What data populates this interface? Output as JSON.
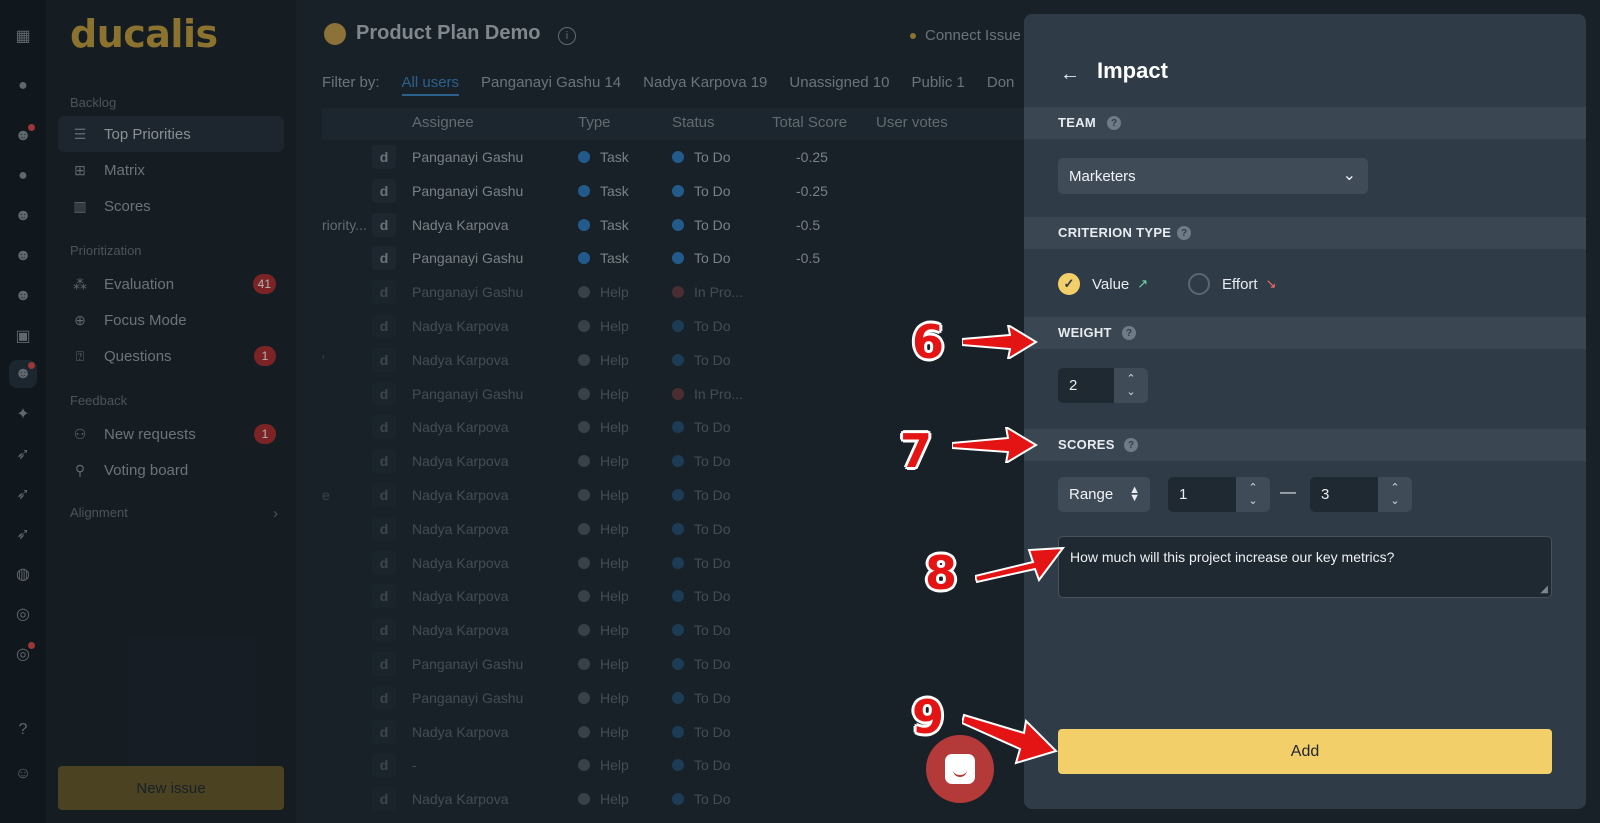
{
  "app": {
    "logo": "ducalis",
    "project_title": "Product Plan Demo",
    "connect_label": "Connect Issue"
  },
  "sidebar": {
    "sections": [
      {
        "title": "Backlog",
        "items": [
          {
            "label": "Top Priorities",
            "icon": "list-icon",
            "active": true
          },
          {
            "label": "Matrix",
            "icon": "grid-icon"
          },
          {
            "label": "Scores",
            "icon": "columns-icon"
          }
        ]
      },
      {
        "title": "Prioritization",
        "items": [
          {
            "label": "Evaluation",
            "icon": "nodes-icon",
            "badge": "41"
          },
          {
            "label": "Focus Mode",
            "icon": "target-icon"
          },
          {
            "label": "Questions",
            "icon": "question-box-icon",
            "badge": "1"
          }
        ]
      },
      {
        "title": "Feedback",
        "items": [
          {
            "label": "New requests",
            "icon": "people-icon",
            "badge": "1"
          },
          {
            "label": "Voting board",
            "icon": "pin-icon"
          }
        ]
      }
    ],
    "alignment_label": "Alignment",
    "new_issue_label": "New issue"
  },
  "filters": {
    "label": "Filter by:",
    "options": [
      "All users",
      "Panganayi Gashu 14",
      "Nadya Karpova 19",
      "Unassigned 10",
      "Public 1",
      "Don"
    ]
  },
  "table": {
    "headers": [
      "Assignee",
      "Type",
      "Status",
      "Total Score",
      "User votes"
    ],
    "rows": [
      {
        "title": "",
        "avatar": "d",
        "assignee": "Panganayi Gashu",
        "type": "Task",
        "type_color": "#2f7fc4",
        "status": "To Do",
        "status_color": "#2f7fc4",
        "score": "-0.25",
        "dim": false
      },
      {
        "title": "",
        "avatar": "d",
        "assignee": "Panganayi Gashu",
        "type": "Task",
        "type_color": "#2f7fc4",
        "status": "To Do",
        "status_color": "#2f7fc4",
        "score": "-0.25",
        "dim": false
      },
      {
        "title": "riority...",
        "avatar": "d",
        "assignee": "Nadya Karpova",
        "type": "Task",
        "type_color": "#2f7fc4",
        "status": "To Do",
        "status_color": "#2f7fc4",
        "score": "-0.5",
        "dim": false
      },
      {
        "title": "",
        "avatar": "d",
        "assignee": "Panganayi Gashu",
        "type": "Task",
        "type_color": "#2f7fc4",
        "status": "To Do",
        "status_color": "#2f7fc4",
        "score": "-0.5",
        "dim": false
      },
      {
        "title": "",
        "avatar": "d",
        "assignee": "Panganayi Gashu",
        "type": "Help",
        "type_color": "#8a939b",
        "status": "In Pro...",
        "status_color": "#c0504d",
        "score": "",
        "dim": true
      },
      {
        "title": "",
        "avatar": "d",
        "assignee": "Nadya Karpova",
        "type": "Help",
        "type_color": "#8a939b",
        "status": "To Do",
        "status_color": "#2f7fc4",
        "score": "",
        "dim": true
      },
      {
        "title": "'",
        "avatar": "d",
        "assignee": "Nadya Karpova",
        "type": "Help",
        "type_color": "#8a939b",
        "status": "To Do",
        "status_color": "#2f7fc4",
        "score": "",
        "dim": true
      },
      {
        "title": "",
        "avatar": "d",
        "assignee": "Panganayi Gashu",
        "type": "Help",
        "type_color": "#8a939b",
        "status": "In Pro...",
        "status_color": "#c0504d",
        "score": "",
        "dim": true
      },
      {
        "title": "",
        "avatar": "d",
        "assignee": "Nadya Karpova",
        "type": "Help",
        "type_color": "#8a939b",
        "status": "To Do",
        "status_color": "#2f7fc4",
        "score": "",
        "dim": true
      },
      {
        "title": "",
        "avatar": "d",
        "assignee": "Nadya Karpova",
        "type": "Help",
        "type_color": "#8a939b",
        "status": "To Do",
        "status_color": "#2f7fc4",
        "score": "",
        "dim": true
      },
      {
        "title": "e",
        "avatar": "d",
        "assignee": "Nadya Karpova",
        "type": "Help",
        "type_color": "#8a939b",
        "status": "To Do",
        "status_color": "#2f7fc4",
        "score": "",
        "dim": true
      },
      {
        "title": "",
        "avatar": "d",
        "assignee": "Nadya Karpova",
        "type": "Help",
        "type_color": "#8a939b",
        "status": "To Do",
        "status_color": "#2f7fc4",
        "score": "",
        "dim": true
      },
      {
        "title": "",
        "avatar": "d",
        "assignee": "Nadya Karpova",
        "type": "Help",
        "type_color": "#8a939b",
        "status": "To Do",
        "status_color": "#2f7fc4",
        "score": "",
        "dim": true
      },
      {
        "title": "",
        "avatar": "d",
        "assignee": "Nadya Karpova",
        "type": "Help",
        "type_color": "#8a939b",
        "status": "To Do",
        "status_color": "#2f7fc4",
        "score": "",
        "dim": true
      },
      {
        "title": "",
        "avatar": "d",
        "assignee": "Nadya Karpova",
        "type": "Help",
        "type_color": "#8a939b",
        "status": "To Do",
        "status_color": "#2f7fc4",
        "score": "",
        "dim": true
      },
      {
        "title": "",
        "avatar": "d",
        "assignee": "Panganayi Gashu",
        "type": "Help",
        "type_color": "#8a939b",
        "status": "To Do",
        "status_color": "#2f7fc4",
        "score": "",
        "dim": true
      },
      {
        "title": "",
        "avatar": "d",
        "assignee": "Panganayi Gashu",
        "type": "Help",
        "type_color": "#8a939b",
        "status": "To Do",
        "status_color": "#2f7fc4",
        "score": "",
        "dim": true
      },
      {
        "title": "",
        "avatar": "d",
        "assignee": "Nadya Karpova",
        "type": "Help",
        "type_color": "#8a939b",
        "status": "To Do",
        "status_color": "#2f7fc4",
        "score": "",
        "dim": true
      },
      {
        "title": "",
        "avatar": "d",
        "assignee": "-",
        "type": "Help",
        "type_color": "#8a939b",
        "status": "To Do",
        "status_color": "#2f7fc4",
        "score": "",
        "dim": true
      },
      {
        "title": "",
        "avatar": "d",
        "assignee": "Nadya Karpova",
        "type": "Help",
        "type_color": "#8a939b",
        "status": "To Do",
        "status_color": "#2f7fc4",
        "score": "",
        "dim": true
      }
    ]
  },
  "panel": {
    "title": "Impact",
    "team_label": "TEAM",
    "team_value": "Marketers",
    "criterion_type_label": "CRITERION TYPE",
    "criterion_options": [
      {
        "label": "Value",
        "checked": true,
        "arrow": "↗"
      },
      {
        "label": "Effort",
        "checked": false,
        "arrow": "↘"
      }
    ],
    "weight_label": "WEIGHT",
    "weight_value": "2",
    "scores_label": "SCORES",
    "scores_mode": "Range",
    "scores_min": "1",
    "scores_dash": "—",
    "scores_max": "3",
    "description": "How much will this project increase our key metrics?",
    "add_label": "Add"
  },
  "annotations": [
    "6",
    "7",
    "8",
    "9"
  ],
  "colors": {
    "accent": "#f3cf6a",
    "brand": "#c9a13b",
    "annotation": "#e41414",
    "badge": "#b32e2e"
  }
}
